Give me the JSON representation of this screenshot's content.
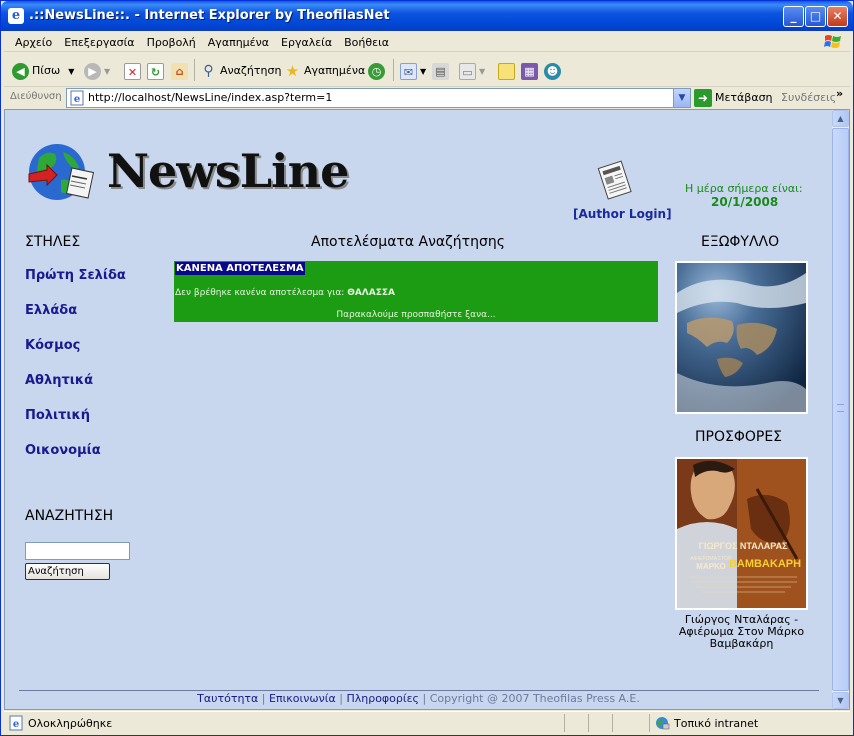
{
  "window": {
    "title": ".::NewsLine::. - Internet Explorer by TheofilasNet",
    "minimize_glyph": "_",
    "maximize_glyph": "□",
    "close_glyph": "✕"
  },
  "menu": [
    "Αρχείο",
    "Επεξεργασία",
    "Προβολή",
    "Αγαπημένα",
    "Εργαλεία",
    "Βοήθεια"
  ],
  "toolbar": {
    "back_label": "Πίσω",
    "search_label": "Αναζήτηση",
    "favorites_label": "Αγαπημένα"
  },
  "address": {
    "label": "Διεύθυνση",
    "url": "http://localhost/NewsLine/index.asp?term=1",
    "go_label": "Μετάβαση",
    "links_label": "Συνδέσεις"
  },
  "page": {
    "logo_text": "NewsLine",
    "author_login": "[Author Login]",
    "date_label": "Η μέρα σήμερα είναι:",
    "date_value": "20/1/2008",
    "columns_title": "ΣΤΗΛΕΣ",
    "nav": [
      "Πρώτη Σελίδα",
      "Ελλάδα",
      "Κόσμος",
      "Αθλητικά",
      "Πολιτική",
      "Οικονομία"
    ],
    "search_title": "ΑΝΑΖΗΤΗΣΗ",
    "search_input_value": "",
    "search_button": "Αναζήτηση",
    "results_title": "Αποτελέσματα Αναζήτησης",
    "no_result": "ΚΑΝΕΝΑ ΑΠΟΤΕΛΕΣΜΑ",
    "not_found_prefix": "Δεν βρέθηκε κανένα αποτέλεσμα για:",
    "search_term": "ΘΑΛΑΣΣΑ",
    "retry": "Παρακαλούμε προσπαθήστε ξανα...",
    "cover_title": "ΕΞΩΦΥΛΛΟ",
    "offers_title": "ΠΡΟΣΦΟΡΕΣ",
    "album_line1": "ΓΙΩΡΓΟΣ ΝΤΑΛΑΡΑΣ",
    "album_line2": "ΑΦΙΕΡΩΜΑ ΣΤΟΝ",
    "album_line3": "ΜΑΡΚΟ",
    "album_line4": "ΒΑΜΒΑΚΑΡΗ",
    "album_caption": "Γιώργος Νταλάρας - Αφιέρωμα Στον Μάρκο Βαμβακάρη",
    "footer": {
      "links": [
        "Ταυτότητα",
        "Επικοινωνία",
        "Πληροφορίες"
      ],
      "copyright": "Copyright @ 2007 Theofilas Press A.E."
    }
  },
  "status": {
    "text": "Ολοκληρώθηκε",
    "zone": "Τοπικό intranet"
  },
  "colors": {
    "page_bg": "#c8d7ee",
    "result_bg": "#1b9c12",
    "nav_link": "#1a1a8e",
    "date_green": "#1a8a1a"
  }
}
